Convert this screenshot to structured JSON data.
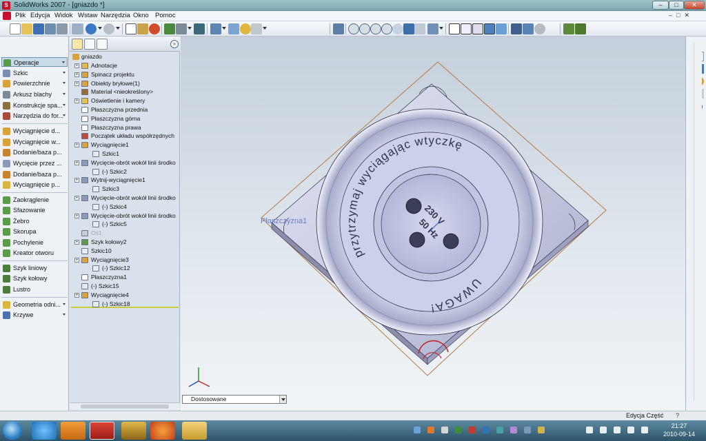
{
  "window": {
    "title": "SolidWorks 2007 - [gniazdo *]"
  },
  "menu": [
    "Plik",
    "Edycja",
    "Widok",
    "Wstaw",
    "Narzędzia",
    "Okno",
    "Pomoc"
  ],
  "command_manager": {
    "items": [
      {
        "label": "Operacje",
        "selected": true,
        "dropdown": true,
        "icon": "features-icon"
      },
      {
        "label": "Szkic",
        "dropdown": true,
        "icon": "sketch-icon"
      },
      {
        "label": "Powierzchnie",
        "dropdown": true,
        "icon": "surfaces-icon"
      },
      {
        "label": "Arkusz blachy",
        "dropdown": true,
        "icon": "sheet-metal-icon"
      },
      {
        "label": "Konstrukcje spa...",
        "dropdown": true,
        "icon": "weldments-icon"
      },
      {
        "label": "Narzędzia do for...",
        "dropdown": true,
        "icon": "mold-tools-icon"
      },
      {
        "label": "Wyciągnięcie d...",
        "icon": "extruded-boss-icon"
      },
      {
        "label": "Wyciągnięcie w...",
        "icon": "revolved-boss-icon"
      },
      {
        "label": "Dodanie/baza p...",
        "icon": "swept-boss-icon"
      },
      {
        "label": "Wycięcie przez ...",
        "icon": "extruded-cut-icon"
      },
      {
        "label": "Dodanie/baza p...",
        "icon": "lofted-boss-icon"
      },
      {
        "label": "Wyciągnięcie p...",
        "icon": "lofted-cut-icon"
      },
      {
        "label": "Zaokrąglenie",
        "icon": "fillet-icon"
      },
      {
        "label": "Sfazowanie",
        "icon": "chamfer-icon"
      },
      {
        "label": "Żebro",
        "icon": "rib-icon"
      },
      {
        "label": "Skorupa",
        "icon": "shell-icon"
      },
      {
        "label": "Pochylenie",
        "icon": "draft-icon"
      },
      {
        "label": "Kreator otworu",
        "icon": "hole-wizard-icon"
      },
      {
        "label": "Szyk liniowy",
        "icon": "linear-pattern-icon"
      },
      {
        "label": "Szyk kołowy",
        "icon": "circular-pattern-icon"
      },
      {
        "label": "Lustro",
        "icon": "mirror-icon"
      },
      {
        "label": "Geometria odni...",
        "dropdown": true,
        "icon": "reference-geometry-icon"
      },
      {
        "label": "Krzywe",
        "dropdown": true,
        "icon": "curves-icon"
      }
    ]
  },
  "feature_tree": {
    "root": "gniazdo",
    "items": [
      {
        "label": "Adnotacje",
        "expander": true,
        "icon": "annotations-icon"
      },
      {
        "label": "Spinacz projektu",
        "expander": true,
        "icon": "design-binder-icon"
      },
      {
        "label": "Obiekty bryłowe(1)",
        "expander": true,
        "icon": "solid-bodies-icon"
      },
      {
        "label": "Materiał <nieokreślony>",
        "icon": "material-icon"
      },
      {
        "label": "Oświetlenie i kamery",
        "expander": true,
        "icon": "lights-icon"
      },
      {
        "label": "Płaszczyzna przednia",
        "icon": "plane-icon"
      },
      {
        "label": "Płaszczyzna górna",
        "icon": "plane-icon"
      },
      {
        "label": "Płaszczyzna prawa",
        "icon": "plane-icon"
      },
      {
        "label": "Początek układu współrzędnych",
        "icon": "origin-icon"
      },
      {
        "label": "Wyciągnięcie1",
        "expander": true,
        "icon": "extrude-icon"
      },
      {
        "label": "Szkic1",
        "child": true,
        "icon": "sketch-icon"
      },
      {
        "label": "Wycięcie-obrót wokół linii środko",
        "expander": true,
        "icon": "revolve-cut-icon"
      },
      {
        "label": "(-) Szkic2",
        "child": true,
        "icon": "sketch-icon"
      },
      {
        "label": "Wytnij-wyciągnięcie1",
        "expander": true,
        "icon": "cut-extrude-icon"
      },
      {
        "label": "Szkic3",
        "child": true,
        "icon": "sketch-icon"
      },
      {
        "label": "Wycięcie-obrót wokół linii środko",
        "expander": true,
        "icon": "revolve-cut-icon"
      },
      {
        "label": "(-) Szkic4",
        "child": true,
        "icon": "sketch-icon"
      },
      {
        "label": "Wycięcie-obrót wokół linii środko",
        "expander": true,
        "icon": "revolve-cut-icon"
      },
      {
        "label": "(-) Szkic5",
        "child": true,
        "icon": "sketch-icon"
      },
      {
        "label": "Oś1",
        "dim": true,
        "icon": "axis-icon"
      },
      {
        "label": "Szyk kołowy2",
        "expander": true,
        "icon": "circular-pattern-icon"
      },
      {
        "label": "Szkic10",
        "icon": "sketch-icon"
      },
      {
        "label": "Wyciągnięcie3",
        "expander": true,
        "icon": "extrude-icon"
      },
      {
        "label": "(-) Szkic12",
        "child": true,
        "icon": "sketch-icon"
      },
      {
        "label": "Płaszczyzna1",
        "icon": "plane-icon"
      },
      {
        "label": "(-) Szkic15",
        "icon": "sketch-icon"
      },
      {
        "label": "Wyciągnięcie4",
        "expander": true,
        "icon": "extrude-icon"
      },
      {
        "label": "(-) Szkic18",
        "child": true,
        "icon": "sketch-icon"
      }
    ]
  },
  "viewport": {
    "plane_label": "Płaszczyzna1",
    "display_state": "Dostosowane",
    "model_text": {
      "ring_top": "przytrzymaj wyciągając wtyczkę",
      "ring_bottom": "UWAGA!",
      "voltage": "230 V",
      "frequency": "50 Hz"
    }
  },
  "status_bar": {
    "mode": "Edycja Część"
  },
  "taskbar": {
    "time": "21:27",
    "date": "2010-09-14"
  },
  "colors": {
    "part": "#c7cbe6",
    "part_edge": "#2b2f45",
    "plane_outline": "#b5793f",
    "plane_label": "#6a7cc8"
  }
}
